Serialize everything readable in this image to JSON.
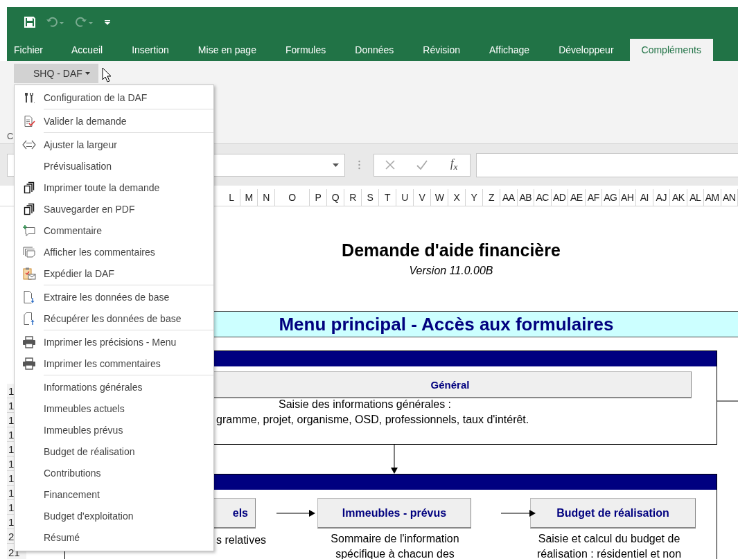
{
  "quick_access": {
    "undo": {
      "disabled": true
    },
    "redo": {
      "disabled": true
    }
  },
  "ribbon_tabs": [
    {
      "label": "Fichier",
      "selected": false
    },
    {
      "label": "Accueil",
      "selected": false
    },
    {
      "label": "Insertion",
      "selected": false
    },
    {
      "label": "Mise en page",
      "selected": false
    },
    {
      "label": "Formules",
      "selected": false
    },
    {
      "label": "Données",
      "selected": false
    },
    {
      "label": "Révision",
      "selected": false
    },
    {
      "label": "Affichage",
      "selected": false
    },
    {
      "label": "Développeur",
      "selected": false
    },
    {
      "label": "Compléments",
      "selected": true
    }
  ],
  "ribbon": {
    "group_label": "C",
    "addin_button": {
      "label": "SHQ - DAF",
      "expanded": true
    }
  },
  "formula_bar": {
    "function_button": "f$_{x}$"
  },
  "column_headers": [
    "L",
    "M",
    "N",
    "O",
    "P",
    "Q",
    "R",
    "S",
    "T",
    "U",
    "V",
    "W",
    "X",
    "Y",
    "Z",
    "AA",
    "AB",
    "AC",
    "AD",
    "AE",
    "AF",
    "AG",
    "AH",
    "AI",
    "AJ",
    "AK",
    "AL",
    "AM",
    "AN"
  ],
  "row_headers": [
    "1",
    "1",
    "1",
    "1",
    "1",
    "1",
    "1",
    "1",
    "1",
    "1",
    "2",
    "21"
  ],
  "sheet": {
    "title": "Demande d'aide financière",
    "version": "Version 11.0.00B",
    "banner": "Menu principal - Accès aux formulaires",
    "general_section": {
      "button": "Général",
      "description_lines": [
        "Saisie des informations générales :",
        "gramme, projet, organisme, OSD, professionnels, taux d'intérêt."
      ]
    },
    "forms_section": {
      "buttons": [
        {
          "label": "els",
          "description_lines": [
            "s relatives"
          ]
        },
        {
          "label": "Immeubles - prévus",
          "description_lines": [
            "Sommaire de l'information",
            "spécifique à chacun des"
          ]
        },
        {
          "label": "Budget de réalisation",
          "description_lines": [
            "Saisie et calcul du budget de",
            "réalisation : résidentiel et non"
          ]
        }
      ]
    }
  },
  "menu": {
    "groups": [
      [
        "Configuration de la DAF"
      ],
      [
        "Valider la demande"
      ],
      [
        "Ajuster la largeur",
        "Prévisualisation",
        "Imprimer toute la demande",
        "Sauvegarder en PDF",
        "Commentaire",
        "Afficher les commentaires",
        "Expédier la DAF"
      ],
      [
        "Extraire les données de base",
        "Récupérer les données de base"
      ],
      [
        "Imprimer les précisions - Menu",
        "Imprimer les commentaires"
      ],
      [
        "Informations générales",
        "Immeubles actuels",
        "Immeubles prévus",
        "Budget de réalisation",
        "Contributions",
        "Financement",
        "Budget d'exploitation",
        "Résumé"
      ]
    ]
  }
}
